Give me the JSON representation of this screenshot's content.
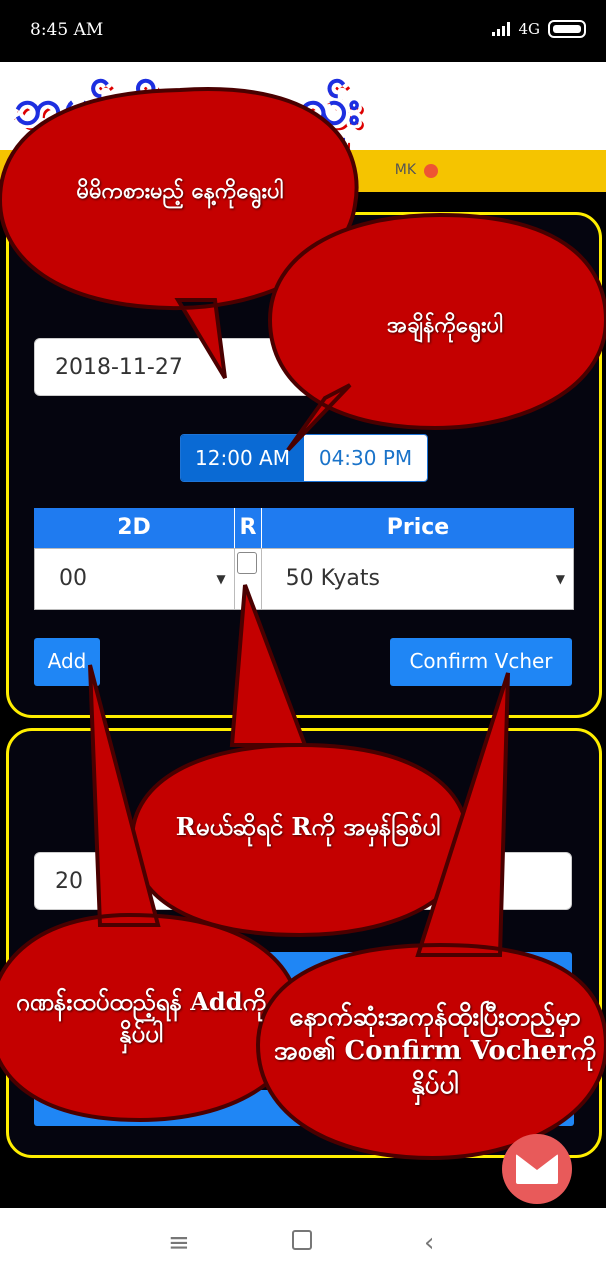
{
  "status_bar": {
    "time": "8:45 AM",
    "network": "4G"
  },
  "banner": {
    "text": "ဘယ်လိုကစားနည်း"
  },
  "header": {
    "yellow_text": "MK"
  },
  "panel1": {
    "date_value": "2018-11-27",
    "time_options": [
      {
        "label": "12:00 AM",
        "selected": true
      },
      {
        "label": "04:30 PM",
        "selected": false
      }
    ],
    "table": {
      "headers": [
        "2D",
        "R",
        "Price"
      ],
      "number_value": "00",
      "price_value": "50 Kyats"
    },
    "add_label": "Add",
    "confirm_label": "Confirm Vcher"
  },
  "panel2": {
    "date_value": "20"
  },
  "tooltips": {
    "select_date": "မိမိကစားမည့် နေ့ကိုရွေးပါ",
    "select_time": "အချိန်ကိုရွေးပါ",
    "r_hint": "Rမယ်ဆိုရင် Rကို အမှန်ခြစ်ပါ",
    "add_hint": "ဂဏန်းထပ်ထည့်ရန် Addကိုနှိပ်ပါ",
    "confirm_hint": "နောက်ဆုံးအကုန်ထိုးပြီးတည့်မှာအစ၏ Confirm Vocherကိုနှိပ်ပါ"
  },
  "colors": {
    "accent_blue": "#1f86f5",
    "panel_border": "#ffee00",
    "bubble_red": "#c40000"
  },
  "icons": {
    "mail": "mail-icon",
    "nav_menu": "menu-icon",
    "nav_home": "home-icon",
    "nav_back": "back-icon"
  }
}
